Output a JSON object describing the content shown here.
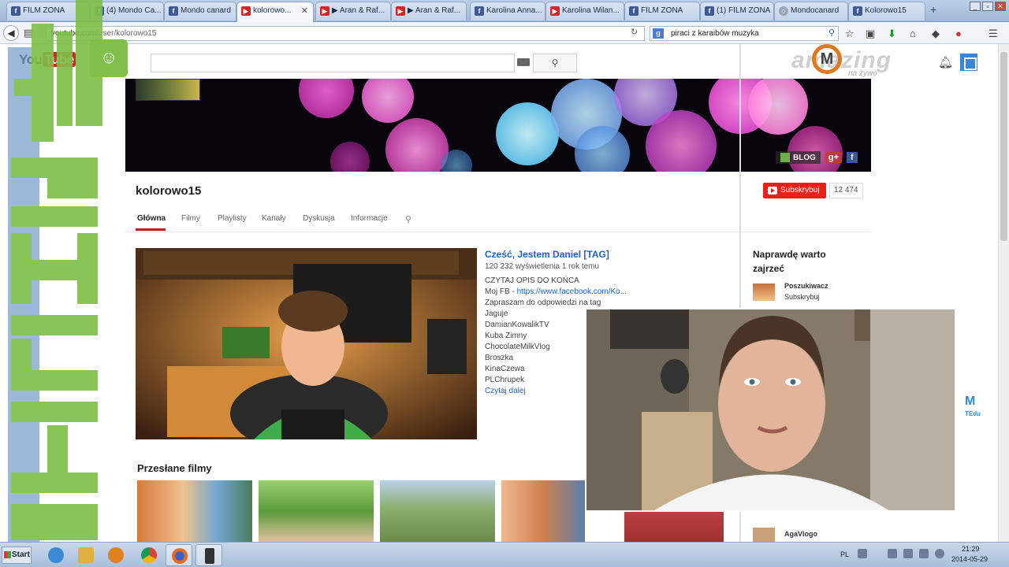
{
  "browser": {
    "tabs": [
      {
        "label": "FILM ZONA",
        "favicon": "fb-icon"
      },
      {
        "label": "(4) Mondo Ca...",
        "favicon": "fb-icon"
      },
      {
        "label": "Mondo canard",
        "favicon": "fb-icon"
      },
      {
        "label": "kolorowo...",
        "favicon": "yt-icon",
        "active": true
      },
      {
        "label": "▶ Aran & Raf...",
        "favicon": "yt-icon"
      },
      {
        "label": "▶ Aran & Raf...",
        "favicon": "yt-icon"
      },
      {
        "label": "Karolina Anna...",
        "favicon": "fb-icon"
      },
      {
        "label": "Karolina Wilan...",
        "favicon": "yt-icon"
      },
      {
        "label": "FILM ZONA",
        "favicon": "fb-icon"
      },
      {
        "label": "(1) FILM ZONA",
        "favicon": "fb-icon"
      },
      {
        "label": "Mondocanard",
        "favicon": "md-icon"
      },
      {
        "label": "Kolorowo15",
        "favicon": "fb-icon"
      }
    ],
    "url_host": "youtube.com",
    "url_path": "/user/kolorowo15",
    "search_value": "piraci z karaibów muzyka"
  },
  "youtube": {
    "logo_you": "You",
    "logo_tube": "Tube",
    "channel_name": "kolorowo15",
    "banner_blog": "BLOG",
    "subscribe_label": "Subskrybuj",
    "subscriber_count": "12 474",
    "tabs": [
      "Główna",
      "Filmy",
      "Playlisty",
      "Kanały",
      "Dyskusja",
      "Informacje"
    ],
    "featured": {
      "title": "Cześć, Jestem Daniel [TAG]",
      "meta": "120 232 wyświetlenia  1 rok temu",
      "desc": [
        "CZYTAJ OPIS DO KOŃCA",
        "Zapraszam do odpowiedzi na tag",
        "Jaguje",
        "DamianKowalikTV",
        "Kuba Zimny",
        "ChocolateMilkVlog",
        "Broszka",
        "KinaCzewa",
        "PLChrupek"
      ],
      "fb_prefix": "Moj FB - ",
      "fb_link": "https://www.facebook.com/Ko...",
      "read_more": "Czytaj dalej"
    },
    "uploads_title": "Przesłane filmy",
    "sidebar": {
      "title": "Naprawdę warto zajrzeć",
      "item1_name": "Poszukiwacz",
      "item1_action": "Subskrybuj",
      "item2_name": "AgaVlogo"
    }
  },
  "watermark": {
    "text": "amazing",
    "sub": "na żywo"
  },
  "taskbar": {
    "start_label": "Start",
    "lang": "PL",
    "time": "21:29",
    "date": "2014-05-29"
  },
  "colors": {
    "accent_red": "#e62117",
    "link_blue": "#1b63c8",
    "overlay_green": "#7fbf4a",
    "overlay_blue": "#5b86c4"
  }
}
